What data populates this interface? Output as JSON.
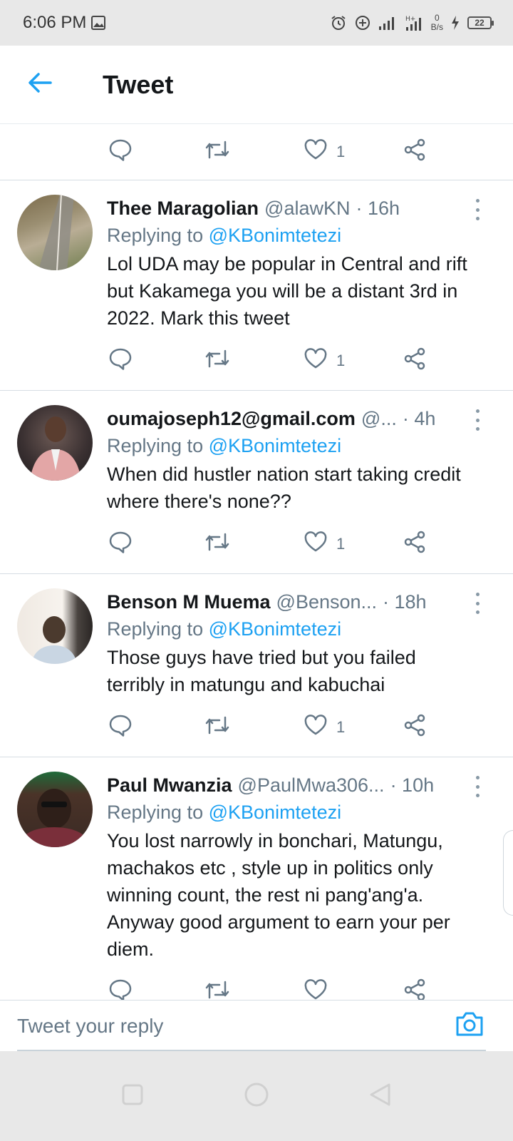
{
  "status_bar": {
    "time": "6:06 PM",
    "net_speed_value": "0",
    "net_speed_unit": "B/s",
    "battery": "22"
  },
  "header": {
    "title": "Tweet"
  },
  "top_actions": {
    "likes": "1"
  },
  "replies": [
    {
      "name": "Thee Maragolian",
      "handle": "@alawKN",
      "time": "· 16h",
      "replying_prefix": "Replying to",
      "replying_to": "@KBonimtetezi",
      "text": "Lol UDA may be popular in Central and rift but Kakamega you will be a distant 3rd in 2022. Mark this tweet",
      "likes": "1"
    },
    {
      "name": "oumajoseph12@gmail.com",
      "handle": "@...",
      "time": "· 4h",
      "replying_prefix": "Replying to",
      "replying_to": "@KBonimtetezi",
      "text": "When did hustler nation start taking credit where there's none??",
      "likes": "1"
    },
    {
      "name": "Benson M Muema",
      "handle": "@Benson...",
      "time": "· 18h",
      "replying_prefix": "Replying to",
      "replying_to": "@KBonimtetezi",
      "text": "Those guys have tried but you failed terribly in matungu and kabuchai",
      "likes": "1"
    },
    {
      "name": "Paul Mwanzia",
      "handle": "@PaulMwa306...",
      "time": "· 10h",
      "replying_prefix": "Replying to",
      "replying_to": "@KBonimtetezi",
      "text": "You lost narrowly in bonchari, Matungu, machakos etc , style up in politics only winning count, the rest ni pang'ang'a. Anyway good argument to earn your per diem."
    }
  ],
  "composer": {
    "placeholder": "Tweet your reply"
  },
  "colors": {
    "accent": "#1da1f2",
    "secondary_text": "#657786",
    "primary_text": "#14171a"
  },
  "icons": [
    "back-arrow-icon",
    "reply-icon",
    "retweet-icon",
    "heart-icon",
    "share-icon",
    "more-icon",
    "camera-icon",
    "nav-recents-icon",
    "nav-home-icon",
    "nav-back-icon"
  ]
}
